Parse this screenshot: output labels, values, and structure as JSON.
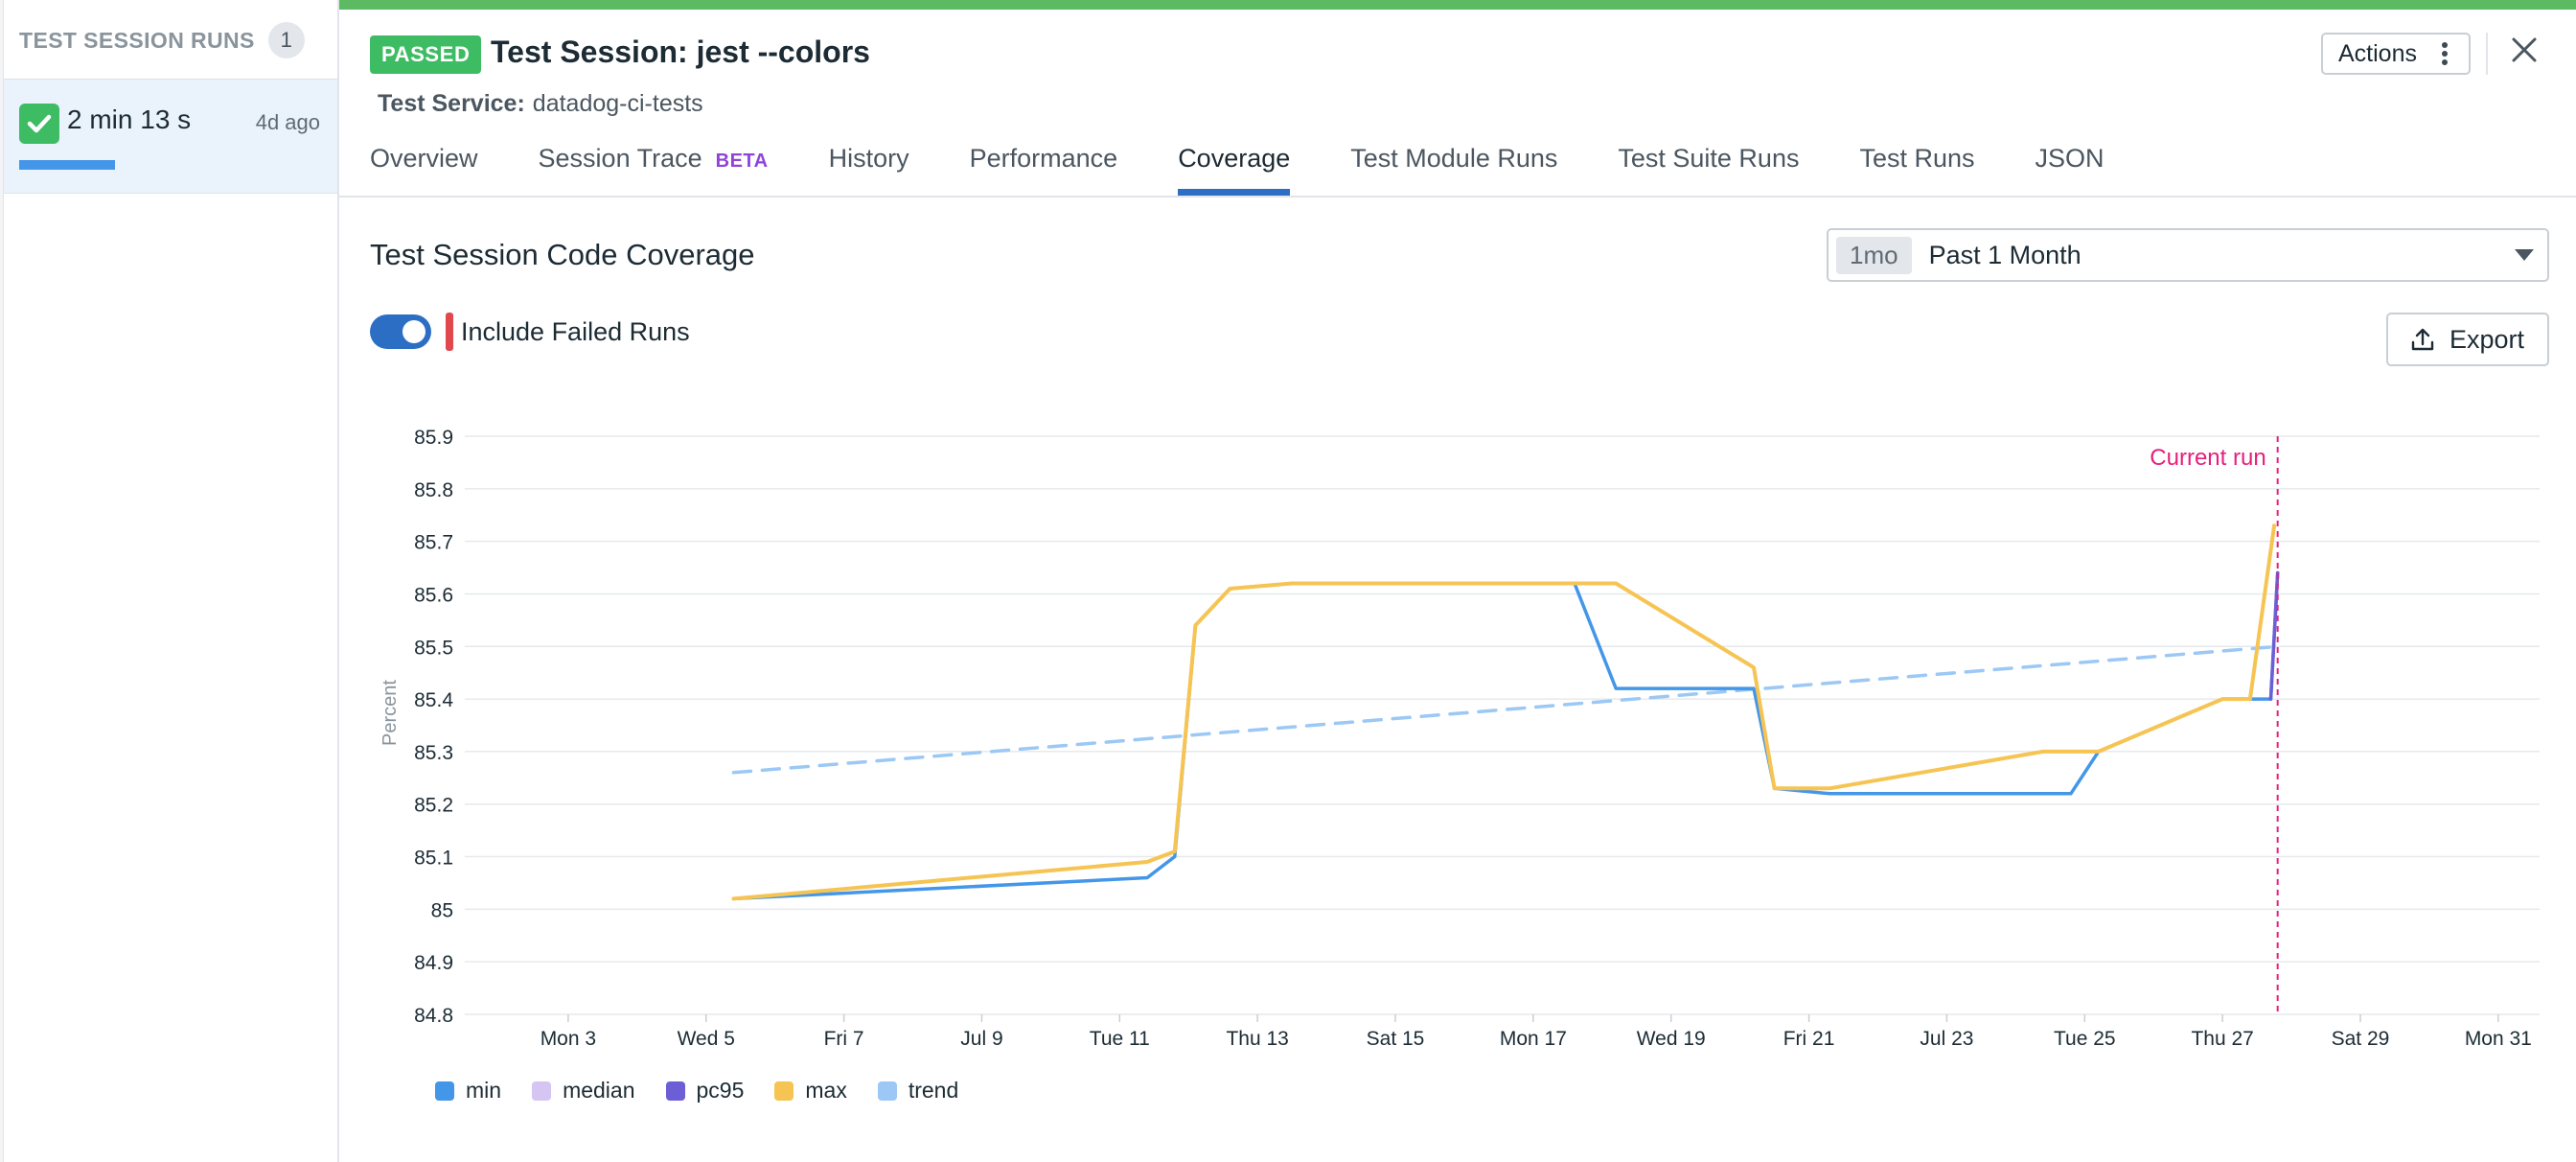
{
  "sidebar": {
    "title": "TEST SESSION RUNS",
    "count": "1",
    "run": {
      "duration": "2 min 13 s",
      "ago": "4d ago"
    }
  },
  "header": {
    "status": "PASSED",
    "title": "Test Session: jest --colors",
    "service_key": "Test Service:",
    "service_value": "datadog-ci-tests",
    "actions_label": "Actions"
  },
  "tabs": [
    {
      "label": "Overview"
    },
    {
      "label": "Session Trace",
      "badge": "BETA"
    },
    {
      "label": "History"
    },
    {
      "label": "Performance"
    },
    {
      "label": "Coverage",
      "active": true
    },
    {
      "label": "Test Module Runs"
    },
    {
      "label": "Test Suite Runs"
    },
    {
      "label": "Test Runs"
    },
    {
      "label": "JSON"
    }
  ],
  "section": {
    "title": "Test Session Code Coverage",
    "range_chip": "1mo",
    "range_label": "Past 1 Month",
    "include_failed_label": "Include Failed Runs",
    "include_failed": true,
    "export_label": "Export"
  },
  "colors": {
    "min": "#4396e8",
    "median": "#d5c5f3",
    "pc95": "#6c5fd6",
    "max": "#f6c453",
    "trend": "#9cc8f5",
    "current_run": "#e5207c"
  },
  "chart_data": {
    "type": "line",
    "ylabel": "Percent",
    "ylim": [
      84.8,
      85.9
    ],
    "yticks": [
      "85.9",
      "85.8",
      "85.7",
      "85.6",
      "85.5",
      "85.4",
      "85.3",
      "85.2",
      "85.1",
      "85",
      "84.9",
      "84.8"
    ],
    "xlim": [
      1.5,
      31.6
    ],
    "xticks": [
      {
        "d": 3,
        "label": "Mon 3"
      },
      {
        "d": 5,
        "label": "Wed 5"
      },
      {
        "d": 7,
        "label": "Fri 7"
      },
      {
        "d": 9,
        "label": "Jul 9"
      },
      {
        "d": 11,
        "label": "Tue 11"
      },
      {
        "d": 13,
        "label": "Thu 13"
      },
      {
        "d": 15,
        "label": "Sat 15"
      },
      {
        "d": 17,
        "label": "Mon 17"
      },
      {
        "d": 19,
        "label": "Wed 19"
      },
      {
        "d": 21,
        "label": "Fri 21"
      },
      {
        "d": 23,
        "label": "Jul 23"
      },
      {
        "d": 25,
        "label": "Tue 25"
      },
      {
        "d": 27,
        "label": "Thu 27"
      },
      {
        "d": 29,
        "label": "Sat 29"
      },
      {
        "d": 31,
        "label": "Mon 31"
      }
    ],
    "current_run": {
      "x": 27.8,
      "label": "Current run"
    },
    "series": [
      {
        "name": "min",
        "x": [
          5.4,
          11.4,
          11.8,
          12.1,
          12.6,
          13.5,
          17.6,
          18.2,
          20.2,
          20.5,
          21.3,
          24.8,
          25.2,
          27.0,
          27.7,
          27.8
        ],
        "y": [
          85.02,
          85.06,
          85.1,
          85.54,
          85.61,
          85.62,
          85.62,
          85.42,
          85.42,
          85.23,
          85.22,
          85.22,
          85.3,
          85.4,
          85.4,
          85.64
        ]
      },
      {
        "name": "median",
        "x": [],
        "y": []
      },
      {
        "name": "pc95",
        "x": [
          27.7,
          27.8
        ],
        "y": [
          85.4,
          85.64
        ]
      },
      {
        "name": "max",
        "x": [
          5.4,
          11.4,
          11.8,
          12.1,
          12.6,
          13.5,
          17.6,
          18.2,
          20.2,
          20.5,
          21.3,
          24.4,
          24.8,
          25.2,
          27.0,
          27.4,
          27.75
        ],
        "y": [
          85.02,
          85.09,
          85.11,
          85.54,
          85.61,
          85.62,
          85.62,
          85.62,
          85.46,
          85.23,
          85.23,
          85.3,
          85.3,
          85.3,
          85.4,
          85.4,
          85.73
        ]
      },
      {
        "name": "trend",
        "x": [
          5.4,
          27.8
        ],
        "y": [
          85.26,
          85.5
        ]
      }
    ]
  }
}
